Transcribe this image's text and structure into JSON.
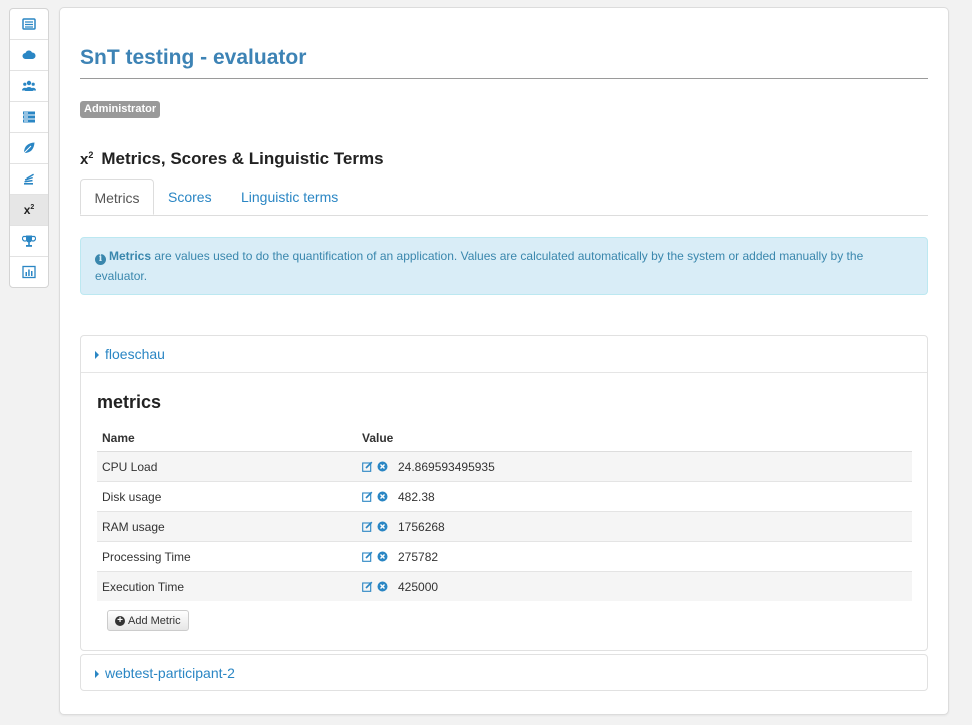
{
  "sidebar": {
    "items": [
      {
        "icon": "list-icon",
        "active": false
      },
      {
        "icon": "cloud-icon",
        "active": false
      },
      {
        "icon": "users-icon",
        "active": false
      },
      {
        "icon": "server-icon",
        "active": false
      },
      {
        "icon": "leaf-icon",
        "active": false
      },
      {
        "icon": "stack-icon",
        "active": false
      },
      {
        "icon": "superscript-icon",
        "label": "x",
        "sup": "2",
        "active": true
      },
      {
        "icon": "trophy-icon",
        "active": false
      },
      {
        "icon": "bar-chart-icon",
        "active": false
      }
    ]
  },
  "header": {
    "title": "SnT testing - evaluator",
    "role_badge": "Administrator"
  },
  "section": {
    "icon_text": "x",
    "icon_sup": "2",
    "title": "Metrics, Scores & Linguistic Terms"
  },
  "tabs": [
    {
      "label": "Metrics",
      "active": true
    },
    {
      "label": "Scores",
      "active": false
    },
    {
      "label": "Linguistic terms",
      "active": false
    }
  ],
  "alert": {
    "bold": "Metrics",
    "text": " are values used to do the quantification of an application. Values are calculated automatically by the system or added manually by the evaluator."
  },
  "participants": [
    {
      "name": "floeschau",
      "expanded": true,
      "heading": "metrics",
      "columns": [
        "Name",
        "Value"
      ],
      "rows": [
        {
          "name": "CPU Load",
          "value": "24.869593495935"
        },
        {
          "name": "Disk usage",
          "value": "482.38"
        },
        {
          "name": "RAM usage",
          "value": "1756268"
        },
        {
          "name": "Processing Time",
          "value": "275782"
        },
        {
          "name": "Execution Time",
          "value": "425000"
        }
      ],
      "add_label": "Add Metric"
    },
    {
      "name": "webtest-participant-2",
      "expanded": false
    }
  ],
  "colors": {
    "link": "#2a86c4",
    "title": "#3d83b5",
    "alert_bg": "#d9edf7",
    "badge": "#999999"
  }
}
